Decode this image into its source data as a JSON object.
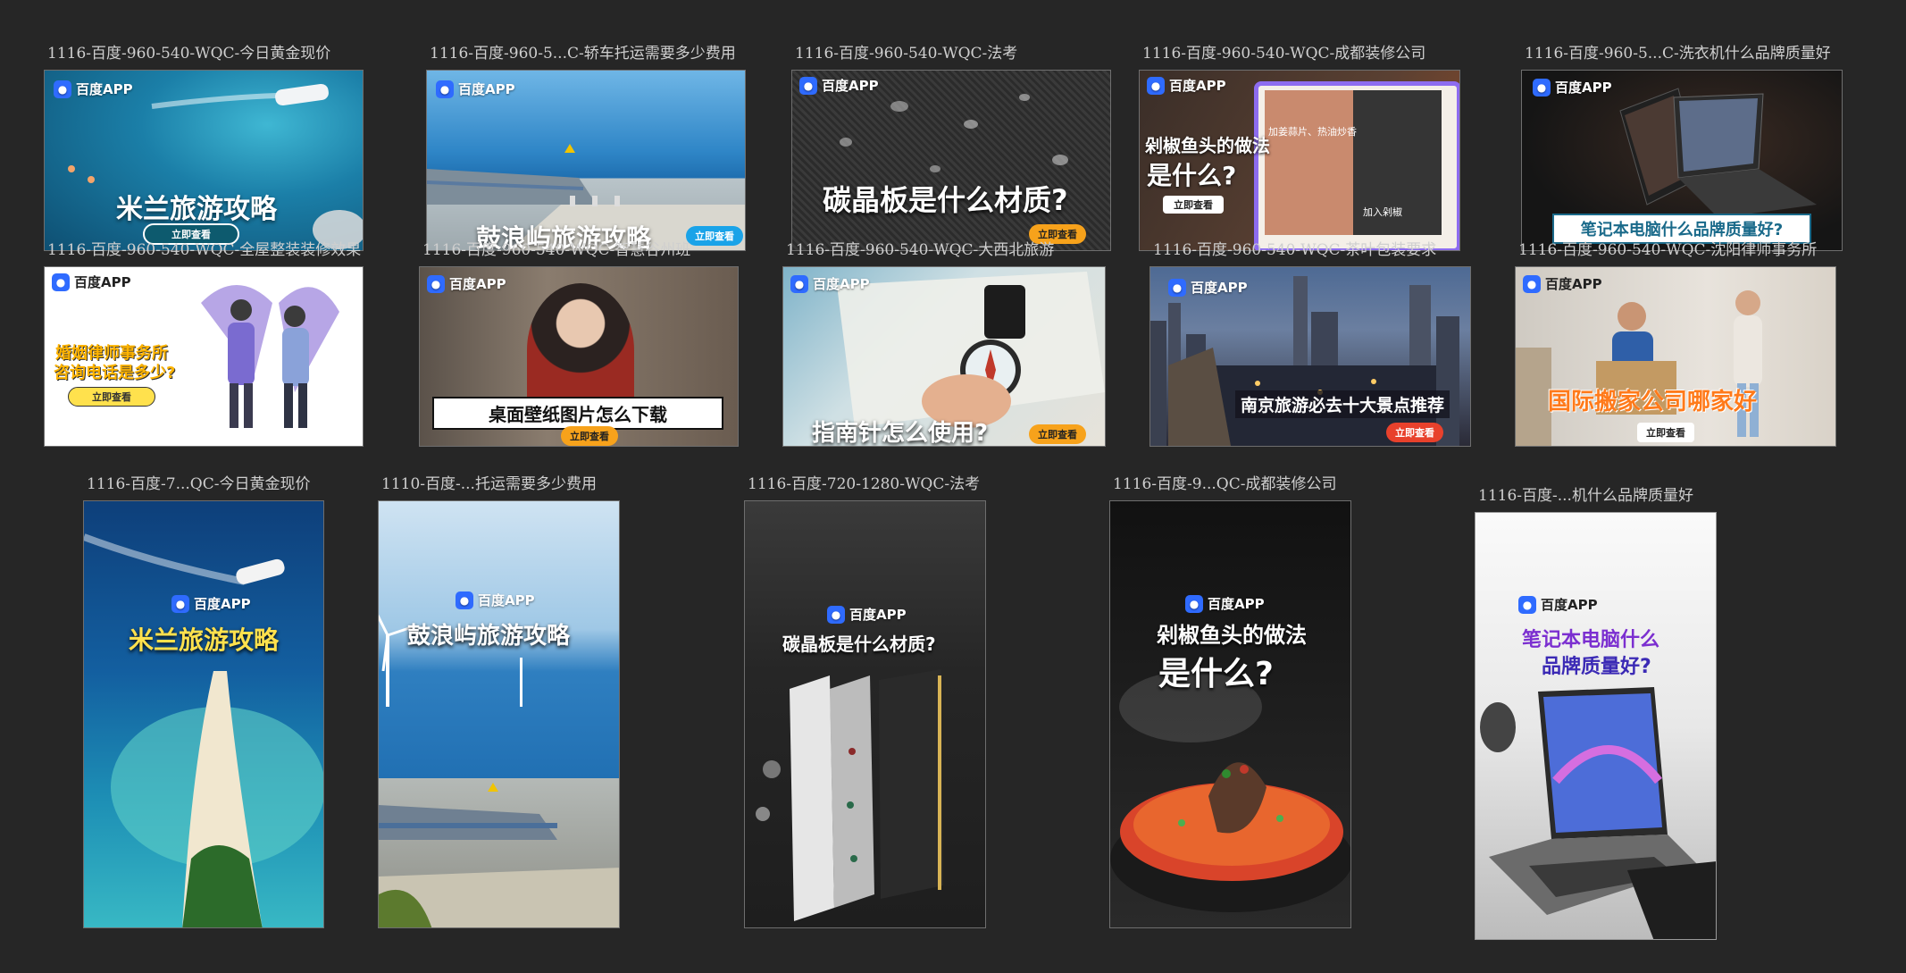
{
  "colors": {
    "canvas": "#262626",
    "label": "#cfcfcf",
    "baidu_blue": "#2f6bff",
    "cta_orange": "#f7a21b",
    "cta_blue": "#1aa3e8",
    "cta_red": "#e8412c",
    "highlight_yellow": "#ffe14d"
  },
  "brand": {
    "name": "百度APP",
    "icon": "baidu-paw-icon"
  },
  "row1": [
    {
      "label": "1116-百度-960-540-WQC-今日黄金现价",
      "headline": "米兰旅游攻略",
      "cta": "立即查看",
      "theme": "sea-boat"
    },
    {
      "label": "1116-百度-960-5...C-轿车托运需要多少费用",
      "headline": "鼓浪屿旅游攻略",
      "cta": "立即查看",
      "theme": "coast-road"
    },
    {
      "label": "1116-百度-960-540-WQC-法考",
      "headline": "碳晶板是什么材质?",
      "cta": "立即查看",
      "theme": "carbon"
    },
    {
      "label": "1116-百度-960-540-WQC-成都装修公司",
      "headline_line1": "剁椒鱼头的做法",
      "headline_line2": "是什么?",
      "cta": "立即查看",
      "photo_text_1": "加姜蒜片、热油炒香",
      "photo_text_2": "加入剁椒",
      "theme": "fish"
    },
    {
      "label": "1116-百度-960-5...C-洗衣机什么品牌质量好",
      "headline": "笔记本电脑什么品牌质量好?",
      "theme": "laptop"
    }
  ],
  "row2": [
    {
      "label": "1116-百度-960-540-WQC-全屋整装装修效果",
      "headline_line1": "婚姻律师事务所",
      "headline_line2": "咨询电话是多少?",
      "cta": "立即查看",
      "theme": "lawyer"
    },
    {
      "label": "1116-百度-960-540-WQC-智慧谷州班",
      "headline": "桌面壁纸图片怎么下载",
      "cta": "立即查看",
      "theme": "wallpaper"
    },
    {
      "label": "1116-百度-960-540-WQC-大西北旅游",
      "headline": "指南针怎么使用?",
      "cta": "立即查看",
      "theme": "compass"
    },
    {
      "label": "1116-百度-960-540-WQC-茶叶包装要求",
      "headline": "南京旅游必去十大景点推荐",
      "cta": "立即查看",
      "theme": "city"
    },
    {
      "label": "1116-百度-960-540-WQC-沈阳律师事务所",
      "headline": "国际搬家公司哪家好",
      "cta": "立即查看",
      "theme": "moving"
    }
  ],
  "row3": [
    {
      "label": "1116-百度-7...QC-今日黄金现价",
      "headline": "米兰旅游攻略",
      "theme": "sea-boat"
    },
    {
      "label": "1110-百度-...托运需要多少费用",
      "headline": "鼓浪屿旅游攻略",
      "theme": "coast-road"
    },
    {
      "label": "1116-百度-720-1280-WQC-法考",
      "headline": "碳晶板是什么材质?",
      "theme": "carbon"
    },
    {
      "label": "1116-百度-9...QC-成都装修公司",
      "headline_line1": "剁椒鱼头的做法",
      "headline_line2": "是什么?",
      "theme": "fish"
    },
    {
      "label": "1116-百度-...机什么品牌质量好",
      "headline_line1": "笔记本电脑什么",
      "headline_line2": "品牌质量好?",
      "theme": "laptop"
    }
  ]
}
